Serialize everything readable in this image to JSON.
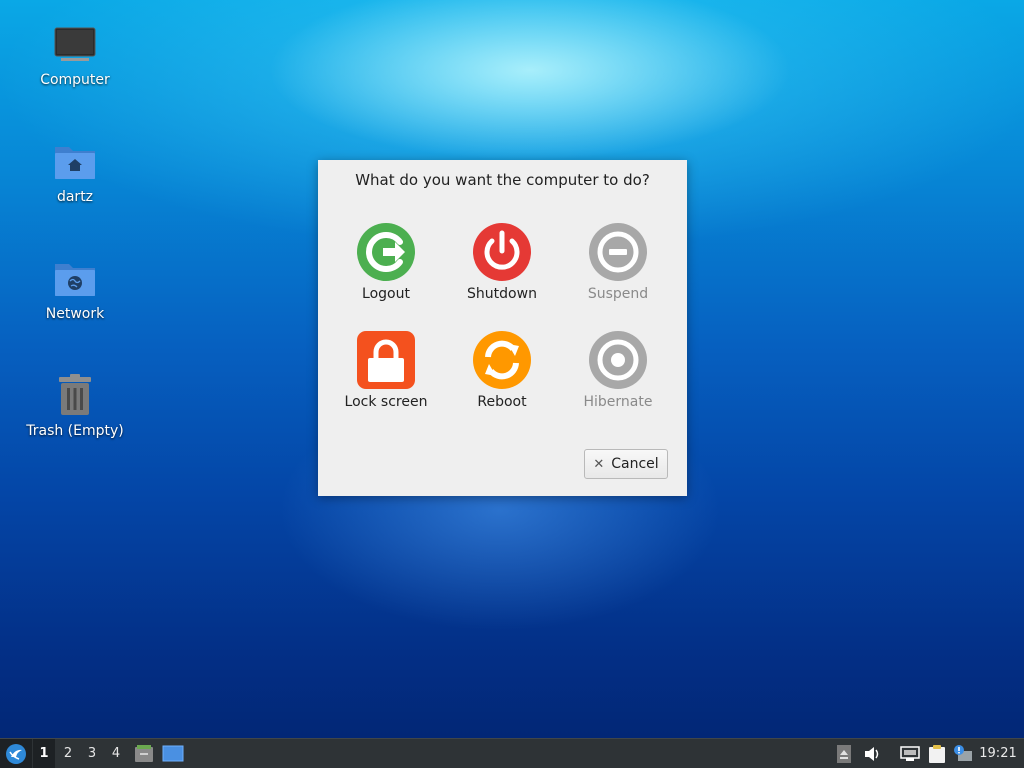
{
  "desktop": {
    "icons": [
      {
        "label": "Computer"
      },
      {
        "label": "dartz"
      },
      {
        "label": "Network"
      },
      {
        "label": "Trash (Empty)"
      }
    ]
  },
  "dialog": {
    "title": "What do you want the computer to do?",
    "actions": [
      {
        "label": "Logout",
        "icon": "logout-icon",
        "color": "#4caf50",
        "enabled": true
      },
      {
        "label": "Shutdown",
        "icon": "power-icon",
        "color": "#e53935",
        "enabled": true
      },
      {
        "label": "Suspend",
        "icon": "suspend-icon",
        "color": "#9e9e9e",
        "enabled": false
      },
      {
        "label": "Lock screen",
        "icon": "lock-icon",
        "color": "#f4511e",
        "enabled": true
      },
      {
        "label": "Reboot",
        "icon": "reboot-icon",
        "color": "#ff9800",
        "enabled": true
      },
      {
        "label": "Hibernate",
        "icon": "hibernate-icon",
        "color": "#9e9e9e",
        "enabled": false
      }
    ],
    "cancel_label": "Cancel",
    "cancel_icon": "close-icon"
  },
  "taskbar": {
    "workspaces": [
      "1",
      "2",
      "3",
      "4"
    ],
    "active_workspace": "1",
    "clock": "19:21",
    "tray_icons": [
      "up-arrow-icon",
      "volume-icon",
      "network-icon",
      "clipboard-icon",
      "notification-icon"
    ],
    "launcher_icons": [
      "file-manager-icon",
      "show-desktop-icon"
    ]
  },
  "colors": {
    "dialog_bg": "#efefef",
    "taskbar_bg": "#2e3336"
  }
}
